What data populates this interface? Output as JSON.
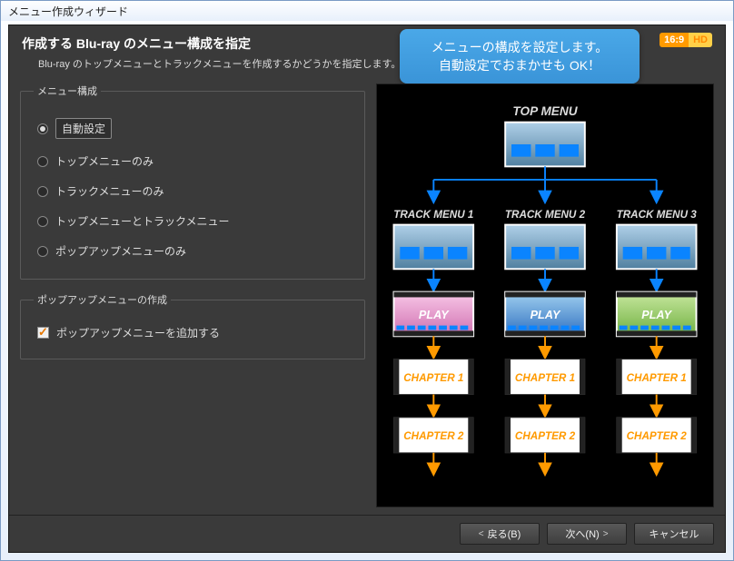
{
  "window": {
    "title": "メニュー作成ウィザード"
  },
  "header": {
    "title": "作成する Blu-ray のメニュー構成を指定",
    "subtitle": "Blu-ray のトップメニューとトラックメニューを作成するかどうかを指定します。"
  },
  "tooltip": {
    "line1": "メニューの構成を設定します。",
    "line2": "自動設定でおまかせも OK！"
  },
  "badge": {
    "ratio": "16:9",
    "hd": "HD"
  },
  "menu_group": {
    "legend": "メニュー構成",
    "options": [
      {
        "label": "自動設定",
        "selected": true
      },
      {
        "label": "トップメニューのみ",
        "selected": false
      },
      {
        "label": "トラックメニューのみ",
        "selected": false
      },
      {
        "label": "トップメニューとトラックメニュー",
        "selected": false
      },
      {
        "label": "ポップアップメニューのみ",
        "selected": false
      }
    ]
  },
  "popup_group": {
    "legend": "ポップアップメニューの作成",
    "checkbox_label": "ポップアップメニューを追加する",
    "checked": true
  },
  "preview": {
    "top_menu": "TOP MENU",
    "tracks": [
      "TRACK MENU 1",
      "TRACK MENU 2",
      "TRACK MENU 3"
    ],
    "play": "PLAY",
    "chapter1": "CHAPTER 1",
    "chapter2": "CHAPTER 2"
  },
  "footer": {
    "back": "戻る(B)",
    "next": "次へ(N)",
    "cancel": "キャンセル"
  }
}
